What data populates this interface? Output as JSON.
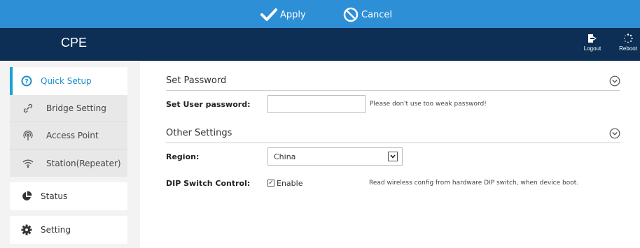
{
  "topbar": {
    "apply_label": "Apply",
    "cancel_label": "Cancel"
  },
  "header": {
    "brand": "CPE",
    "logout_label": "Logout",
    "reboot_label": "Reboot"
  },
  "sidebar": {
    "quick_setup": "Quick Setup",
    "sub_items": [
      {
        "label": "Bridge Setting",
        "icon": "link-icon"
      },
      {
        "label": "Access Point",
        "icon": "access-point-icon"
      },
      {
        "label": "Station(Repeater)",
        "icon": "wifi-icon"
      }
    ],
    "status": "Status",
    "setting": "Setting"
  },
  "main": {
    "set_password": {
      "title": "Set Password",
      "user_password_label": "Set User password:",
      "user_password_value": "",
      "hint": "Please don't use too weak password!"
    },
    "other_settings": {
      "title": "Other Settings",
      "region_label": "Region:",
      "region_value": "China",
      "dip_label": "DIP Switch Control:",
      "dip_enable_label": "Enable",
      "dip_checked": true,
      "dip_hint": "Read wireless config from hardware DIP switch, when device boot."
    }
  },
  "colors": {
    "topbar": "#2d8fd6",
    "header": "#0d2f55",
    "accent": "#1a8fd1"
  }
}
